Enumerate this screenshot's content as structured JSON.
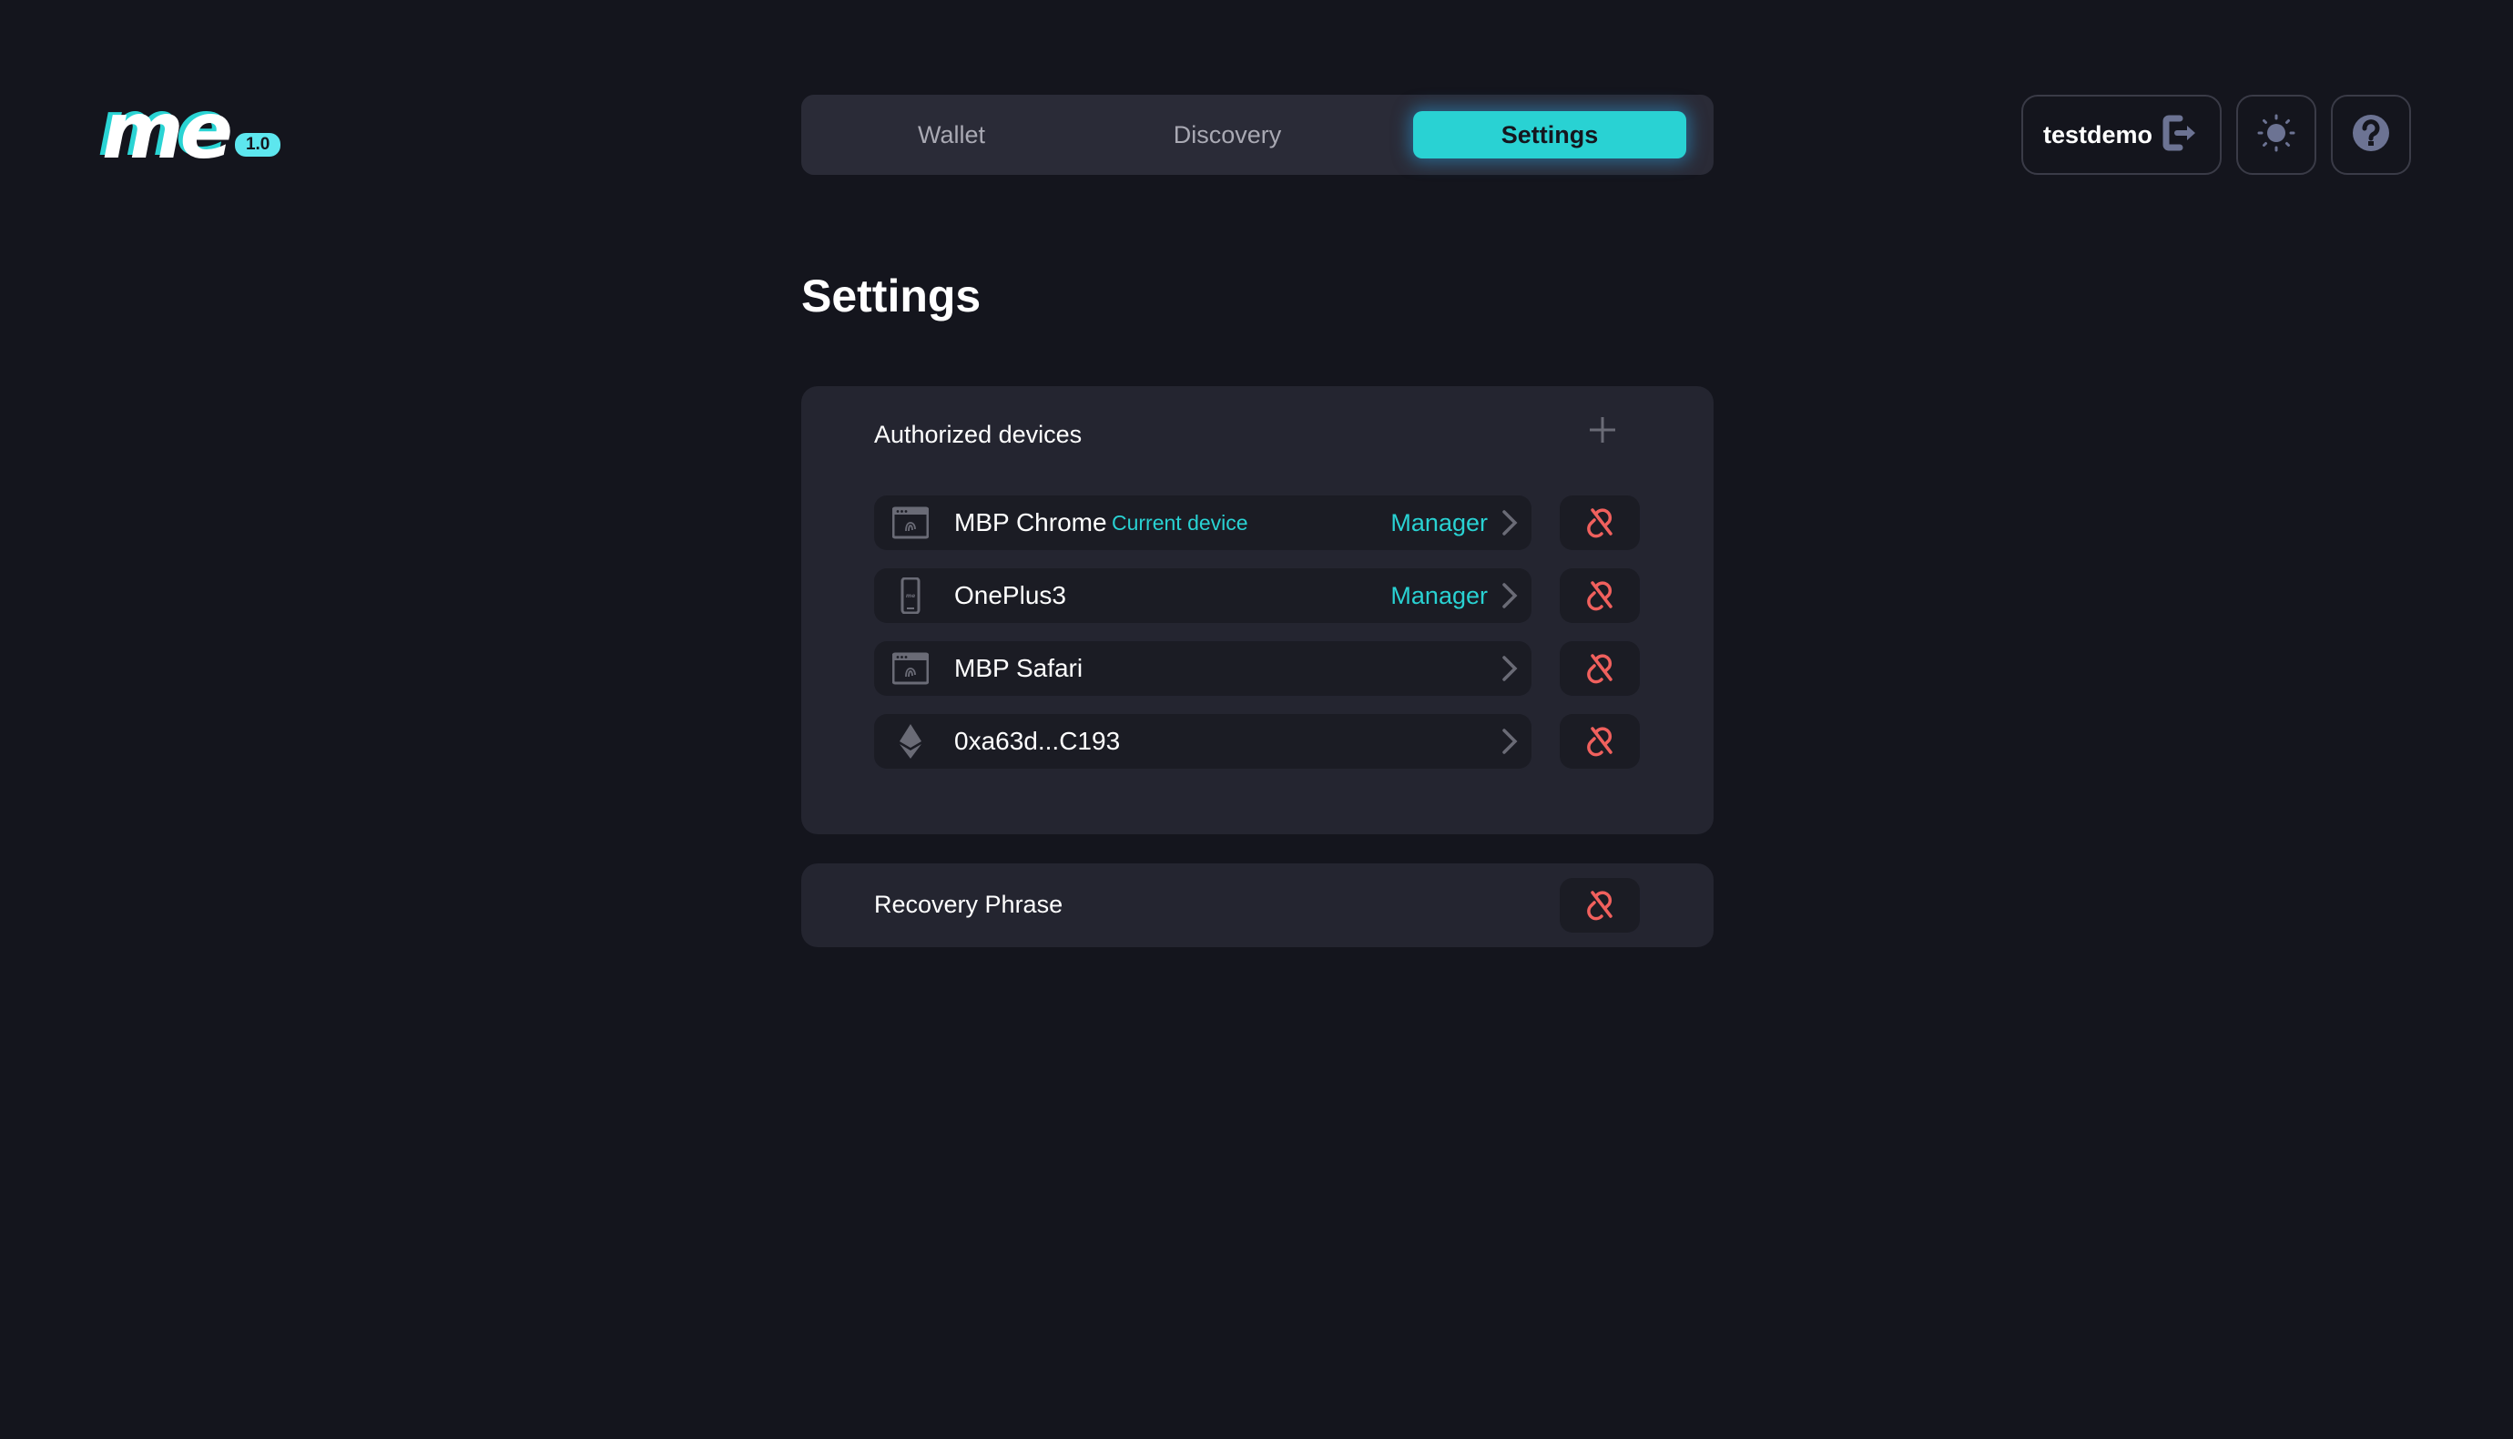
{
  "logo": {
    "text": "me",
    "version": "1.0"
  },
  "nav": {
    "tabs": [
      {
        "label": "Wallet",
        "active": false
      },
      {
        "label": "Discovery",
        "active": false
      },
      {
        "label": "Settings",
        "active": true
      }
    ]
  },
  "header": {
    "username": "testdemo",
    "logout_icon": "logout-icon",
    "theme_icon": "sun-icon",
    "help_icon": "help-circle-icon"
  },
  "page": {
    "title": "Settings"
  },
  "authorized_devices": {
    "title": "Authorized devices",
    "add_icon": "plus-icon",
    "devices": [
      {
        "name": "MBP Chrome",
        "icon": "browser-fingerprint-icon",
        "badge": "Current device",
        "role": "Manager"
      },
      {
        "name": "OnePlus3",
        "icon": "smartphone-icon",
        "badge": "",
        "role": "Manager"
      },
      {
        "name": "MBP Safari",
        "icon": "browser-fingerprint-icon",
        "badge": "",
        "role": ""
      },
      {
        "name": "0xa63d...C193",
        "icon": "ethereum-icon",
        "badge": "",
        "role": ""
      }
    ]
  },
  "recovery": {
    "title": "Recovery Phrase",
    "action_icon": "unlink-icon"
  },
  "colors": {
    "accent": "#29d2d3",
    "danger": "#f0605d",
    "background": "#14151d",
    "card": "#242530",
    "row": "#1b1c24"
  }
}
